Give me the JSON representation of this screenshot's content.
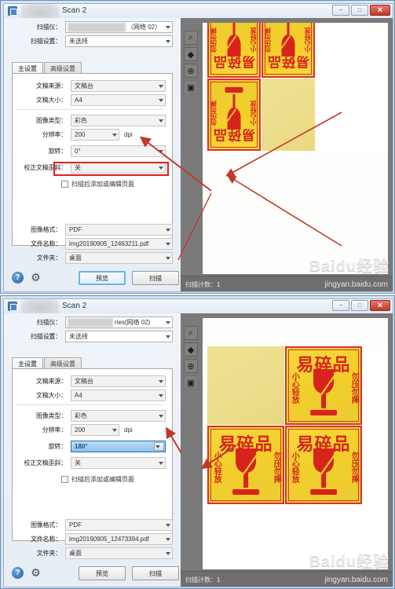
{
  "app": {
    "title": "Scan 2",
    "window_buttons": {
      "minimize": "–",
      "maximize": "□",
      "close": "✕"
    }
  },
  "top_form": {
    "scanner_label": "扫描仪：",
    "scanner_value": "（网络 02）",
    "scanner_value_2": "ries(网络 02)",
    "settings_label": "扫描设置：",
    "settings_value": "未选择"
  },
  "tabs": [
    {
      "label": "主设置",
      "active": true
    },
    {
      "label": "高级设置",
      "active": false
    }
  ],
  "settings": {
    "source_label": "文稿来源：",
    "source_value": "文稿台",
    "size_label": "文稿大小：",
    "size_value": "A4",
    "imgtype_label": "图像类型：",
    "imgtype_value": "彩色",
    "res_label": "分辨率：",
    "res_value": "200",
    "res_unit": "dpi",
    "rotate_label": "旋转：",
    "rotate_value_window1": "0°",
    "rotate_value_window2": "180°",
    "deskew_label": "校正文稿歪斜：",
    "deskew_value": "关",
    "checkbox_label": "扫描后添加或编辑页面"
  },
  "output": {
    "format_label": "图像格式：",
    "format_value": "PDF",
    "filename_label": "文件名称：",
    "filename_value_window1": "img20190905_12463211.pdf",
    "filename_value_window2": "img20190905_12473394.pdf",
    "folder_label": "文件夹：",
    "folder_value": "桌面"
  },
  "footer": {
    "help_icon": "?",
    "gear_icon": "⚙",
    "preview_button": "预览",
    "scan_button": "扫描"
  },
  "preview_toolbar": {
    "icons": [
      "search-icon",
      "pan-icon",
      "zoom-in-icon",
      "fit-icon"
    ],
    "glyphs": [
      "⌕",
      "◆",
      "⊕",
      "▣"
    ],
    "close_glyph": "✕"
  },
  "statusbar": {
    "count_text": "扫描计数：1"
  },
  "watermark": {
    "big": "Baidu经验",
    "small": "jingyan.baidu.com"
  },
  "sticker": {
    "title": "易碎品",
    "left_text": "小心轻放",
    "right_text": "勿压勿摔"
  },
  "colors": {
    "sticker_yellow": "#f2cf2a",
    "sticker_red": "#d8231c",
    "highlight_red": "#e02020",
    "selection_blue": "#3399ff",
    "accent_blue": "#6cb4e4"
  }
}
